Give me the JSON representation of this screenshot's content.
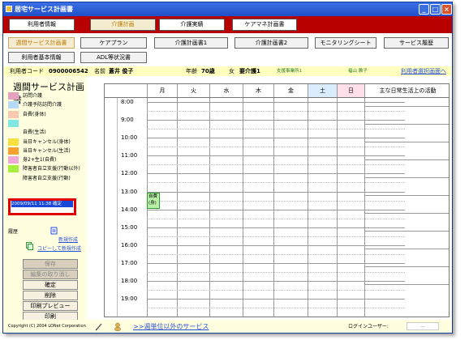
{
  "window": {
    "title": "居宅サービス計画書"
  },
  "nav": [
    {
      "label": "利用者情報"
    },
    {
      "label": "介護計画"
    },
    {
      "label": "介護実績"
    },
    {
      "label": "ケアマネ計画書"
    }
  ],
  "subnav": {
    "row1": [
      {
        "label": "週間サービス計画書"
      },
      {
        "label": "ケアプラン"
      },
      {
        "label": "介護計画書1"
      },
      {
        "label": "介護計画書2"
      },
      {
        "label": "モニタリングシート"
      },
      {
        "label": "サービス履歴"
      }
    ],
    "row2": [
      {
        "label": "利用者基本情報"
      },
      {
        "label": "ADL等状況書"
      }
    ]
  },
  "user": {
    "code_label": "利用者コード",
    "code": "0900006542",
    "name_label": "名前",
    "name": "蒼井 俊子",
    "age_label": "年齢",
    "age": "70歳",
    "sex": "女",
    "care_level": "要介護1",
    "office": "支援事業所1",
    "staff": "福山 雅子",
    "select_link": "利用者選択画面へ"
  },
  "sidebar": {
    "title": "週間サービス計画書",
    "legend": [
      {
        "label": "訪問介護",
        "color": "#e8a0c0"
      },
      {
        "label": "介護予防訪問介護",
        "color": "#b8d8f8"
      },
      {
        "label": "自費(身体)",
        "color": "#f8c8b0"
      },
      {
        "label": "",
        "color": "#80e8e0"
      },
      {
        "label": "自費(生活)",
        "color": "#ffffe0"
      },
      {
        "label": "当日キャンセル(身体)",
        "color": "#f8e040"
      },
      {
        "label": "当日キャンセル(生活)",
        "color": "#f8a030"
      },
      {
        "label": "身2+生1(自費)",
        "color": "#f0a8d8"
      },
      {
        "label": "障害者自立支援(行動以外)",
        "color": "#a8f040"
      },
      {
        "label": "障害者自立支援(行動)",
        "color": "#ffffe0"
      }
    ],
    "history_entry": "2009/09/11 11:38 確定",
    "history_label": "履歴",
    "new_link": "新規作成",
    "copy_link": "コピーして新規作成",
    "buttons": [
      {
        "label": "保存",
        "state": "disabled"
      },
      {
        "label": "編集の取り消し",
        "state": "disabled"
      },
      {
        "label": "確定",
        "state": "enabled"
      },
      {
        "label": "削除",
        "state": "enabled"
      },
      {
        "label": "印刷プレビュー",
        "state": "enabled"
      },
      {
        "label": "印刷",
        "state": "enabled"
      }
    ]
  },
  "schedule": {
    "days": [
      "月",
      "火",
      "水",
      "木",
      "金",
      "土",
      "日"
    ],
    "activity_header": "主な日常生活上の活動",
    "times": [
      "8:00",
      "9:00",
      "10:00",
      "11:00",
      "12:00",
      "13:00",
      "14:00",
      "15:00",
      "16:00",
      "17:00",
      "18:00",
      "19:00"
    ],
    "event": {
      "day": "月",
      "time": "13:00",
      "label_line1": "自費",
      "label_line2": "(身)"
    }
  },
  "footer": {
    "copyright": "Copyright (C) 2004 LONet Corporation",
    "link": ">>週単位以外のサービス",
    "login_label": "ログインユーザー:",
    "login_value": "..."
  }
}
